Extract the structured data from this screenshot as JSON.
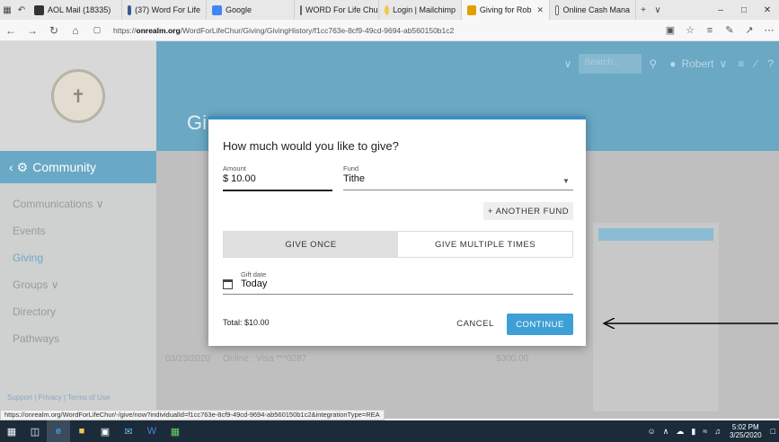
{
  "browser": {
    "tabs": [
      {
        "label": "AOL Mail (18335)",
        "color": "#333333",
        "active": false
      },
      {
        "label": "(37) Word For Life",
        "color": "#3b5998",
        "active": false
      },
      {
        "label": "Google",
        "color": "#4285f4",
        "active": false
      },
      {
        "label": "WORD For Life Chu",
        "color": "#666666",
        "active": false
      },
      {
        "label": "Login | Mailchimp",
        "color": "#f2c94c",
        "active": false
      },
      {
        "label": "Giving for Rob",
        "color": "#e0a000",
        "active": true
      },
      {
        "label": "Online Cash Mana",
        "color": "#666666",
        "active": false
      }
    ],
    "url_domain": "onrealm.org",
    "url_prefix": "https://",
    "url_path": "/WordForLifeChur/Giving/GivingHistory/f1cc763e-8cf9-49cd-9694-ab560150b1c2",
    "status_url": "https://onrealm.org/WordForLifeChur/-/give/now?individualId=f1cc763e-8cf9-49cd-9694-ab560150b1c2&integrationType=REA"
  },
  "page": {
    "sidebar_title": "Community",
    "sidebar_items": [
      "Communications",
      "Events",
      "Giving",
      "Groups",
      "Directory",
      "Pathways"
    ],
    "sidebar_footer": "Support | Privacy | Terms of Use",
    "page_title": "Gi",
    "search_placeholder": "Search...",
    "user_name": "Robert",
    "bg_row_date": "03/23/2020",
    "bg_row_method": "Online : Visa ***0287",
    "bg_row_amount": "$300.00"
  },
  "modal": {
    "title": "How much would you like to give?",
    "amount_label": "Amount",
    "amount_value": "$ 10.00",
    "fund_label": "Fund",
    "fund_value": "Tithe",
    "another_fund": "+ ANOTHER FUND",
    "give_once": "GIVE ONCE",
    "give_multiple": "GIVE MULTIPLE TIMES",
    "gift_date_label": "Gift date",
    "gift_date_value": "Today",
    "total": "Total: $10.00",
    "cancel": "CANCEL",
    "continue": "CONTINUE"
  },
  "taskbar": {
    "time": "5:02 PM",
    "date": "3/25/2020"
  },
  "colors": {
    "accent": "#3d9fd3",
    "header_blue": "#6aa8c4"
  }
}
